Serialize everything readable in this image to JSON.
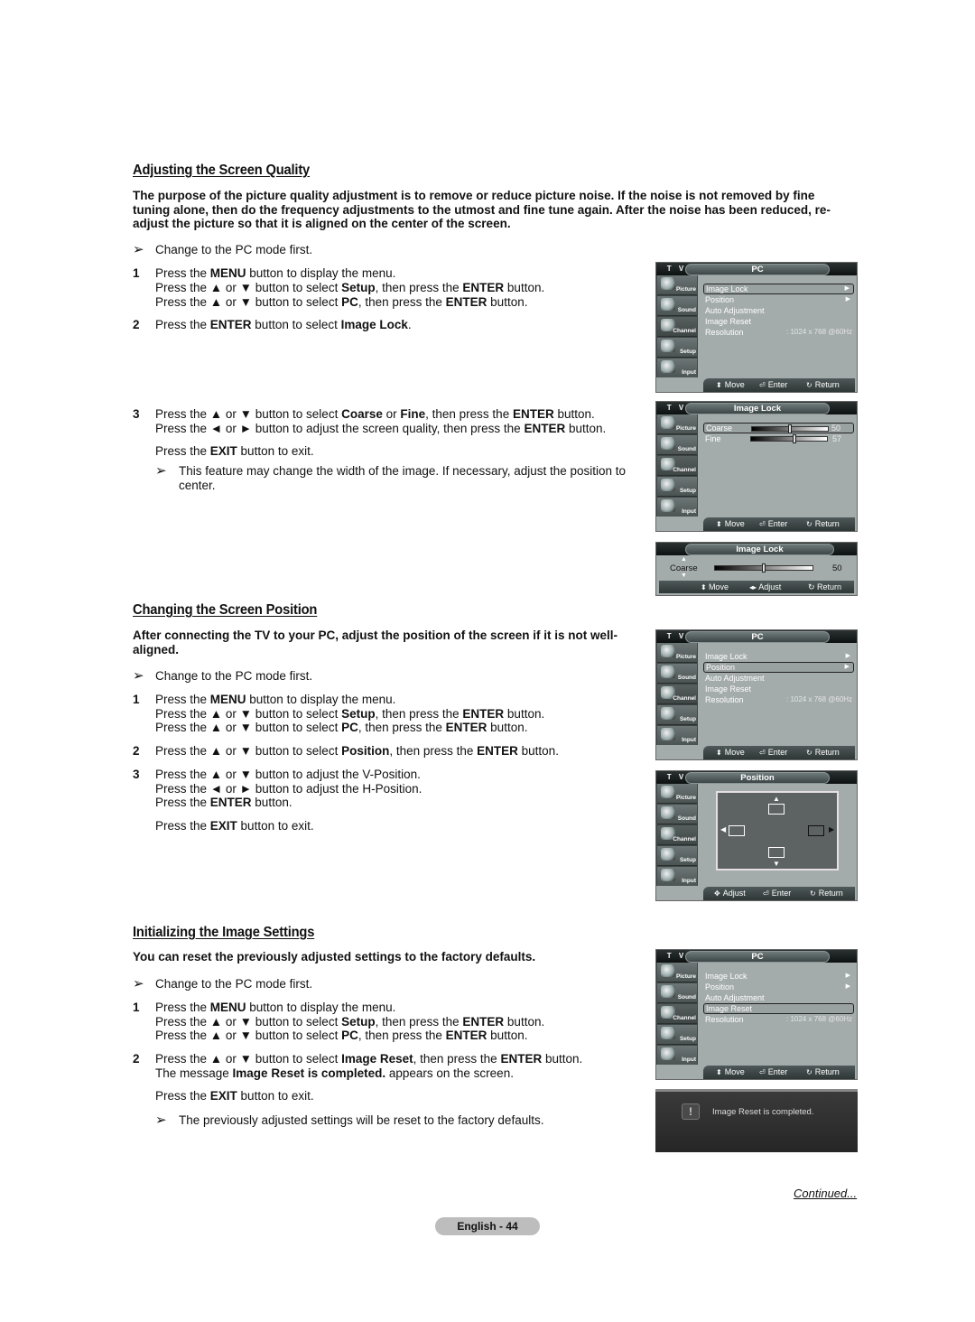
{
  "sections": {
    "quality": {
      "title": "Adjusting the Screen Quality",
      "intro": "The purpose of the picture quality adjustment is to remove or reduce picture noise. If the noise is not removed by fine tuning alone, then do the frequency adjustments to the utmost and fine tune again. After the noise has been reduced, re-adjust the picture so that it is aligned on the center of the screen.",
      "note_first": "Change to the PC mode first.",
      "steps": [
        {
          "num": "1",
          "lines": [
            [
              "Press the ",
              {
                "b": "MENU"
              },
              " button to display the menu."
            ],
            [
              "Press the ▲ or ▼ button to select ",
              {
                "b": "Setup"
              },
              ", then press the ",
              {
                "b": "ENTER"
              },
              " button."
            ],
            [
              "Press the ▲ or ▼ button to select ",
              {
                "b": "PC"
              },
              ", then press the ",
              {
                "b": "ENTER"
              },
              " button."
            ]
          ]
        },
        {
          "num": "2",
          "lines": [
            [
              "Press the ",
              {
                "b": "ENTER"
              },
              " button to select ",
              {
                "b": "Image Lock"
              },
              "."
            ]
          ]
        },
        {
          "num": "3",
          "lines": [
            [
              "Press the ▲ or ▼ button to select ",
              {
                "b": "Coarse"
              },
              " or ",
              {
                "b": "Fine"
              },
              ", then press the ",
              {
                "b": "ENTER"
              },
              " button."
            ],
            [
              "Press the ◄ or ► button to adjust the screen quality, then press the ",
              {
                "b": "ENTER"
              },
              " button."
            ]
          ]
        }
      ],
      "exit_line": [
        "Press the ",
        {
          "b": "EXIT"
        },
        " button to exit."
      ],
      "note_last": "This feature may change the width of the image. If necessary, adjust the position to center."
    },
    "position": {
      "title": "Changing the Screen Position",
      "intro": "After connecting the TV to your PC, adjust the position of the screen if it is not well-aligned.",
      "note_first": "Change to the PC mode first.",
      "steps": [
        {
          "num": "1",
          "lines": [
            [
              "Press the ",
              {
                "b": "MENU"
              },
              " button to display the menu."
            ],
            [
              "Press the ▲ or ▼ button to select ",
              {
                "b": "Setup"
              },
              ", then press the ",
              {
                "b": "ENTER"
              },
              " button."
            ],
            [
              "Press the ▲ or ▼ button to select ",
              {
                "b": "PC"
              },
              ", then press the ",
              {
                "b": "ENTER"
              },
              " button."
            ]
          ]
        },
        {
          "num": "2",
          "lines": [
            [
              "Press the ▲ or ▼ button to select ",
              {
                "b": "Position"
              },
              ", then press the ",
              {
                "b": "ENTER"
              },
              " button."
            ]
          ]
        },
        {
          "num": "3",
          "lines": [
            [
              "Press the ▲ or ▼ button to adjust the V-Position."
            ],
            [
              "Press the ◄ or ► button to adjust the H-Position."
            ],
            [
              "Press the ",
              {
                "b": "ENTER"
              },
              " button."
            ]
          ]
        }
      ],
      "exit_line": [
        "Press the ",
        {
          "b": "EXIT"
        },
        " button to exit."
      ]
    },
    "reset": {
      "title": "Initializing the Image Settings",
      "intro": "You can reset the previously adjusted settings to the factory defaults.",
      "note_first": "Change to the PC mode first.",
      "steps": [
        {
          "num": "1",
          "lines": [
            [
              "Press the ",
              {
                "b": "MENU"
              },
              " button to display the menu."
            ],
            [
              "Press the ▲ or ▼ button to select ",
              {
                "b": "Setup"
              },
              ", then press the ",
              {
                "b": "ENTER"
              },
              " button."
            ],
            [
              "Press the ▲ or ▼ button to select ",
              {
                "b": "PC"
              },
              ", then press the ",
              {
                "b": "ENTER"
              },
              " button."
            ]
          ]
        },
        {
          "num": "2",
          "lines": [
            [
              "Press the ▲ or ▼ button to select ",
              {
                "b": "Image Reset"
              },
              ", then press the ",
              {
                "b": "ENTER"
              },
              " button."
            ],
            [
              "The message ",
              {
                "b": "Image Reset is completed."
              },
              " appears on the screen."
            ]
          ]
        }
      ],
      "exit_line": [
        "Press the ",
        {
          "b": "EXIT"
        },
        " button to exit."
      ],
      "note_last": "The previously adjusted settings will be reset to the factory defaults."
    }
  },
  "osd": {
    "tv_label": "T V",
    "sidebar": [
      {
        "label": "Picture",
        "icon": "picture-icon"
      },
      {
        "label": "Sound",
        "icon": "sound-icon"
      },
      {
        "label": "Channel",
        "icon": "channel-icon"
      },
      {
        "label": "Setup",
        "icon": "setup-icon"
      },
      {
        "label": "Input",
        "icon": "input-icon"
      }
    ],
    "pc_menu": {
      "title": "PC",
      "items": [
        {
          "label": "Image Lock",
          "arrow": "▶"
        },
        {
          "label": "Position",
          "arrow": "▶"
        },
        {
          "label": "Auto Adjustment"
        },
        {
          "label": "Image Reset"
        },
        {
          "label": "Resolution",
          "value": ": 1024 x 768 @60Hz"
        }
      ]
    },
    "image_lock": {
      "title": "Image Lock",
      "coarse": {
        "label": "Coarse",
        "value": "50",
        "level": 0.5
      },
      "fine": {
        "label": "Fine",
        "value": "57",
        "level": 0.57
      }
    },
    "position_menu": {
      "title": "Position"
    },
    "hints": {
      "move": "Move",
      "enter": "Enter",
      "return": "Return",
      "adjust": "Adjust"
    },
    "reset_message": "Image Reset is completed."
  },
  "footer": {
    "continued": "Continued...",
    "page": "English - 44"
  }
}
